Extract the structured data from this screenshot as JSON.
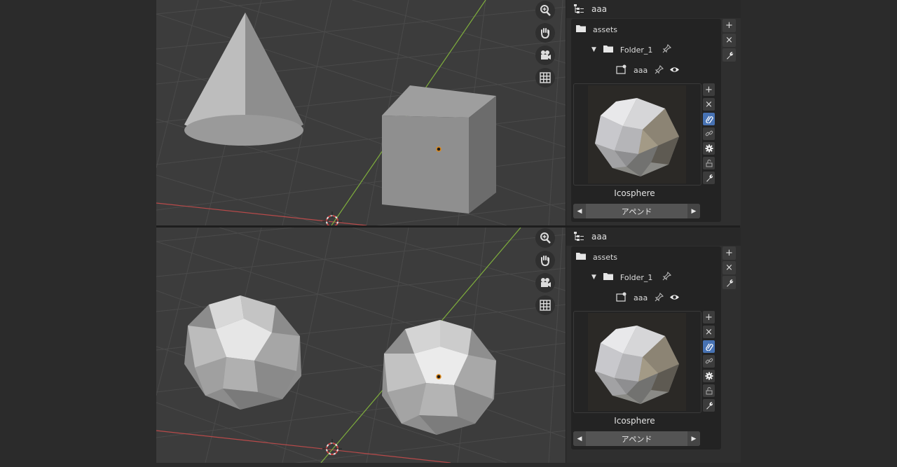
{
  "panels": [
    {
      "id": "top",
      "header": {
        "title": "aaa",
        "icon": "outliner-icon"
      },
      "tree": {
        "root": {
          "label": "assets",
          "icon": "folder-icon"
        },
        "folder": {
          "label": "Folder_1",
          "icon": "folder-icon",
          "expanded": true
        },
        "item": {
          "label": "aaa",
          "icon": "collection-icon"
        }
      },
      "side_buttons": [
        "+",
        "×",
        "wrench-icon"
      ],
      "preview": {
        "asset_name": "Icosphere",
        "append_label": "アペンド",
        "buttons": [
          "add-icon",
          "remove-icon",
          "link-icon-active",
          "chain-icon",
          "gear-icon",
          "lock-icon",
          "wrench-icon"
        ]
      }
    },
    {
      "id": "bottom",
      "header": {
        "title": "aaa",
        "icon": "outliner-icon"
      },
      "tree": {
        "root": {
          "label": "assets",
          "icon": "folder-icon"
        },
        "folder": {
          "label": "Folder_1",
          "icon": "folder-icon",
          "expanded": true
        },
        "item": {
          "label": "aaa",
          "icon": "collection-icon"
        }
      },
      "side_buttons": [
        "+",
        "×",
        "wrench-icon"
      ],
      "preview": {
        "asset_name": "Icosphere",
        "append_label": "アペンド",
        "buttons": [
          "add-icon",
          "remove-icon",
          "link-icon-active",
          "chain-icon",
          "gear-icon",
          "lock-icon",
          "wrench-icon"
        ]
      }
    }
  ],
  "viewport_tools": [
    "zoom-icon",
    "hand-pan-icon",
    "camera-icon",
    "grid-icon"
  ],
  "colors": {
    "viewport_bg": "#3c3c3c",
    "x_axis": "#b84a4a",
    "y_axis": "#7fae3c",
    "active_button": "#4772b3"
  }
}
